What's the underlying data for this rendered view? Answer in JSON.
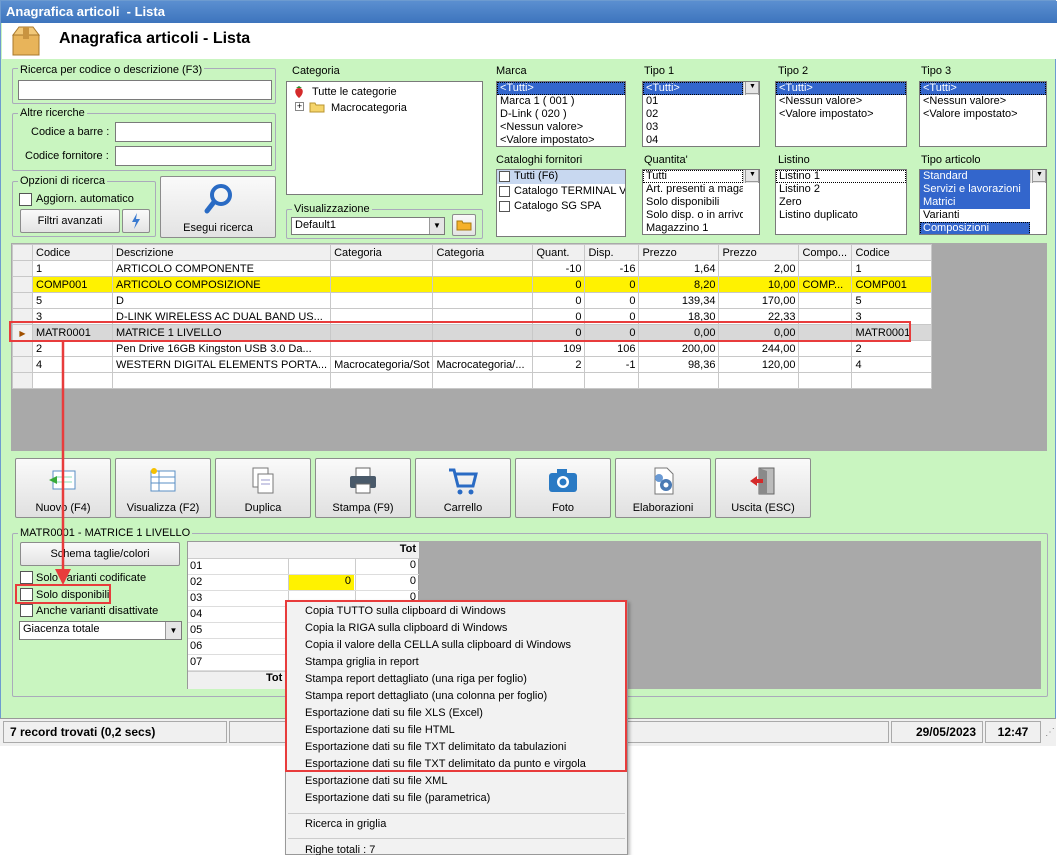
{
  "window": {
    "title": "Anagrafica articoli  - Lista",
    "header": "Anagrafica articoli  - Lista"
  },
  "search": {
    "code_legend": "Ricerca per codice o descrizione (F3)",
    "code_value": "",
    "other_legend": "Altre ricerche",
    "barcode_label": "Codice a barre :",
    "supplier_label": "Codice fornitore :",
    "options_legend": "Opzioni di ricerca",
    "auto_update": "Aggiorn. automatico",
    "advanced_filters": "Filtri avanzati",
    "run_search": "Esegui ricerca"
  },
  "categoria": {
    "legend": "Categoria",
    "items": [
      "Tutte le categorie",
      "Macrocategoria"
    ]
  },
  "visualizzazione": {
    "legend": "Visualizzazione",
    "value": "Default1"
  },
  "marca": {
    "legend": "Marca",
    "items": [
      "<Tutti>",
      "Marca 1 ( 001 )",
      "D-Link ( 020 )",
      "<Nessun valore>",
      "<Valore impostato>"
    ]
  },
  "tipo1": {
    "legend": "Tipo 1",
    "items": [
      "<Tutti>",
      "01",
      "02",
      "03",
      "04"
    ]
  },
  "tipo2": {
    "legend": "Tipo 2",
    "items": [
      "<Tutti>",
      "<Nessun valore>",
      "<Valore impostato>"
    ]
  },
  "tipo3": {
    "legend": "Tipo 3",
    "items": [
      "<Tutti>",
      "<Nessun valore>",
      "<Valore impostato>"
    ]
  },
  "cataloghi": {
    "legend": "Cataloghi fornitori",
    "items": [
      "Tutti (F6)",
      "Catalogo TERMINAL VID",
      "Catalogo SG SPA"
    ]
  },
  "quantita": {
    "legend": "Quantita'",
    "items": [
      "Tutti",
      "Art. presenti a magaz",
      "Solo disponibili",
      "Solo disp. o in arrivo",
      "Magazzino 1"
    ]
  },
  "listino": {
    "legend": "Listino",
    "items": [
      "Listino 1",
      "Listino 2",
      "Zero",
      "Listino duplicato"
    ]
  },
  "tipo_articolo": {
    "legend": "Tipo articolo",
    "items": [
      "Standard",
      "Servizi e lavorazioni",
      "Matrici",
      "Varianti",
      "Composizioni"
    ]
  },
  "grid": {
    "headers": [
      "Codice",
      "Descrizione",
      "Categoria",
      "Categoria",
      "Quant.",
      "Disp.",
      "Prezzo",
      "Prezzo",
      "Compo...",
      "Codice"
    ],
    "rows": [
      [
        "1",
        "ARTICOLO COMPONENTE",
        "",
        "",
        "-10",
        "-16",
        "1,64",
        "2,00",
        "",
        "1"
      ],
      [
        "COMP001",
        "ARTICOLO COMPOSIZIONE",
        "",
        "",
        "0",
        "0",
        "8,20",
        "10,00",
        "COMP...",
        "COMP001"
      ],
      [
        "5",
        "D",
        "",
        "",
        "0",
        "0",
        "139,34",
        "170,00",
        "",
        "5"
      ],
      [
        "3",
        "D-LINK WIRELESS AC DUAL BAND US...",
        "",
        "",
        "0",
        "0",
        "18,30",
        "22,33",
        "",
        "3"
      ],
      [
        "MATR0001",
        "MATRICE 1 LIVELLO",
        "",
        "",
        "0",
        "0",
        "0,00",
        "0,00",
        "",
        "MATR0001"
      ],
      [
        "2",
        "Pen Drive 16GB  Kingston  USB 3.0 Da...",
        "",
        "",
        "109",
        "106",
        "200,00",
        "244,00",
        "",
        "2"
      ],
      [
        "4",
        "WESTERN DIGITAL ELEMENTS PORTA...",
        "Macrocategoria/Sot",
        "Macrocategoria/...",
        "2",
        "-1",
        "98,36",
        "120,00",
        "",
        "4"
      ]
    ]
  },
  "toolbar": {
    "new": "Nuovo (F4)",
    "view": "Visualizza (F2)",
    "duplicate": "Duplica",
    "print": "Stampa (F9)",
    "cart": "Carrello",
    "photo": "Foto",
    "processing": "Elaborazioni",
    "exit": "Uscita (ESC)"
  },
  "detail": {
    "legend": "MATR0001 - MATRICE 1 LIVELLO",
    "scheme_button": "Schema taglie/colori",
    "only_coded": "Solo varianti codificate",
    "only_available": "Solo disponibili",
    "also_disabled": "Anche varianti disattivate",
    "stock_select": "Giacenza totale",
    "grid_header": "Tot",
    "grid_rows": [
      [
        "01",
        "",
        "0"
      ],
      [
        "02",
        "0",
        "0"
      ],
      [
        "03",
        "",
        "0"
      ],
      [
        "04",
        "",
        ""
      ],
      [
        "05",
        "",
        ""
      ],
      [
        "06",
        "",
        ""
      ],
      [
        "07",
        "",
        ""
      ]
    ],
    "total_label": "Tot"
  },
  "status": {
    "records": "7 record trovati (0,2 secs)",
    "date": "29/05/2023",
    "time": "12:47"
  },
  "context_menu": {
    "items": [
      "Copia TUTTO sulla clipboard di Windows",
      "Copia la RIGA sulla clipboard di Windows",
      "Copia il valore della CELLA sulla clipboard di Windows",
      "Stampa griglia in report",
      "Stampa report dettagliato (una riga per foglio)",
      "Stampa report dettagliato (una colonna per foglio)",
      "Esportazione dati su file XLS (Excel)",
      "Esportazione dati su file HTML",
      "Esportazione dati su file TXT delimitato da tabulazioni",
      "Esportazione dati su file TXT delimitato da punto e virgola",
      "Esportazione dati su file XML",
      "Esportazione dati su file (parametrica)"
    ],
    "search_grid": "Ricerca in griglia",
    "total_rows": "Righe totali : 7"
  },
  "colors": {
    "window_bg": "#c9f5c0",
    "selection": "#3366cc",
    "highlight_row": "#fff200",
    "annotation": "#e83c3c"
  }
}
